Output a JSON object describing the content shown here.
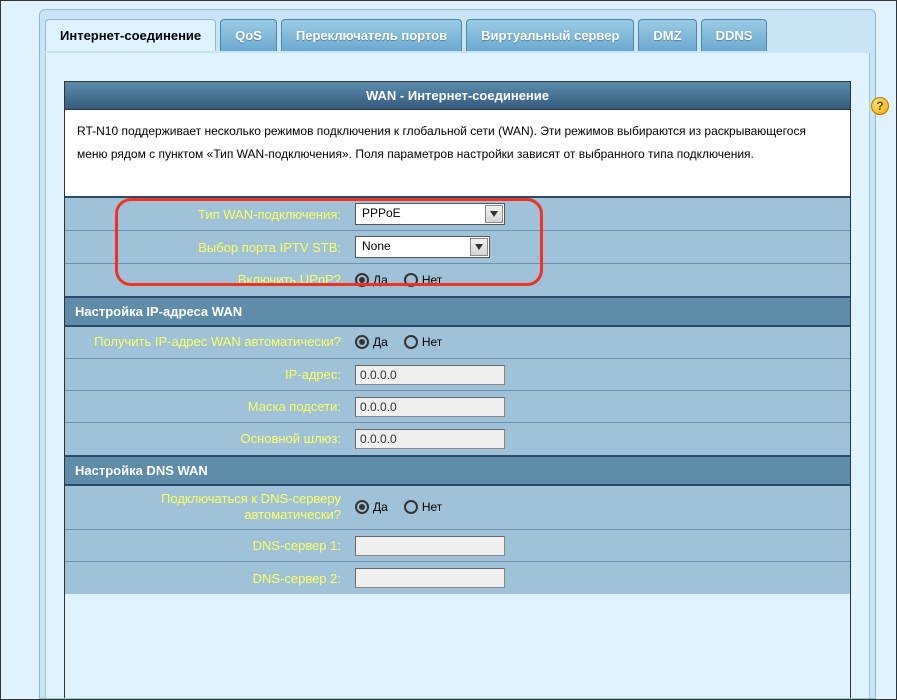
{
  "tabs": {
    "internet": "Интернет-соединение",
    "qos": "QoS",
    "port_trigger": "Переключатель портов",
    "virtual_server": "Виртуальный сервер",
    "dmz": "DMZ",
    "ddns": "DDNS"
  },
  "header": "WAN - Интернет-соединение",
  "description": "RT-N10 поддерживает несколько режимов подключения к глобальной сети (WAN). Эти режимов выбираются из раскрывающегося меню рядом с пунктом «Тип WAN-подключения». Поля параметров настройки зависят от выбранного типа подключения.",
  "fields": {
    "wan_type_label": "Тип WAN-подключения:",
    "wan_type_value": "PPPoE",
    "iptv_label": "Выбор порта IPTV STB:",
    "iptv_value": "None",
    "upnp_label": "Включить UPnP?",
    "yes": "Да",
    "no": "Нет"
  },
  "section_ip": {
    "title": "Настройка IP-адреса WAN",
    "auto_label": "Получить IP-адрес WAN автоматически?",
    "ip_label": "IP-адрес:",
    "ip_value": "0.0.0.0",
    "mask_label": "Маска подсети:",
    "mask_value": "0.0.0.0",
    "gw_label": "Основной шлюз:",
    "gw_value": "0.0.0.0"
  },
  "section_dns": {
    "title": "Настройка DNS WAN",
    "auto_label": "Подключаться к DNS-серверу автоматически?",
    "dns1_label": "DNS-сервер 1:",
    "dns1_value": "",
    "dns2_label": "DNS-сервер 2:",
    "dns2_value": ""
  }
}
